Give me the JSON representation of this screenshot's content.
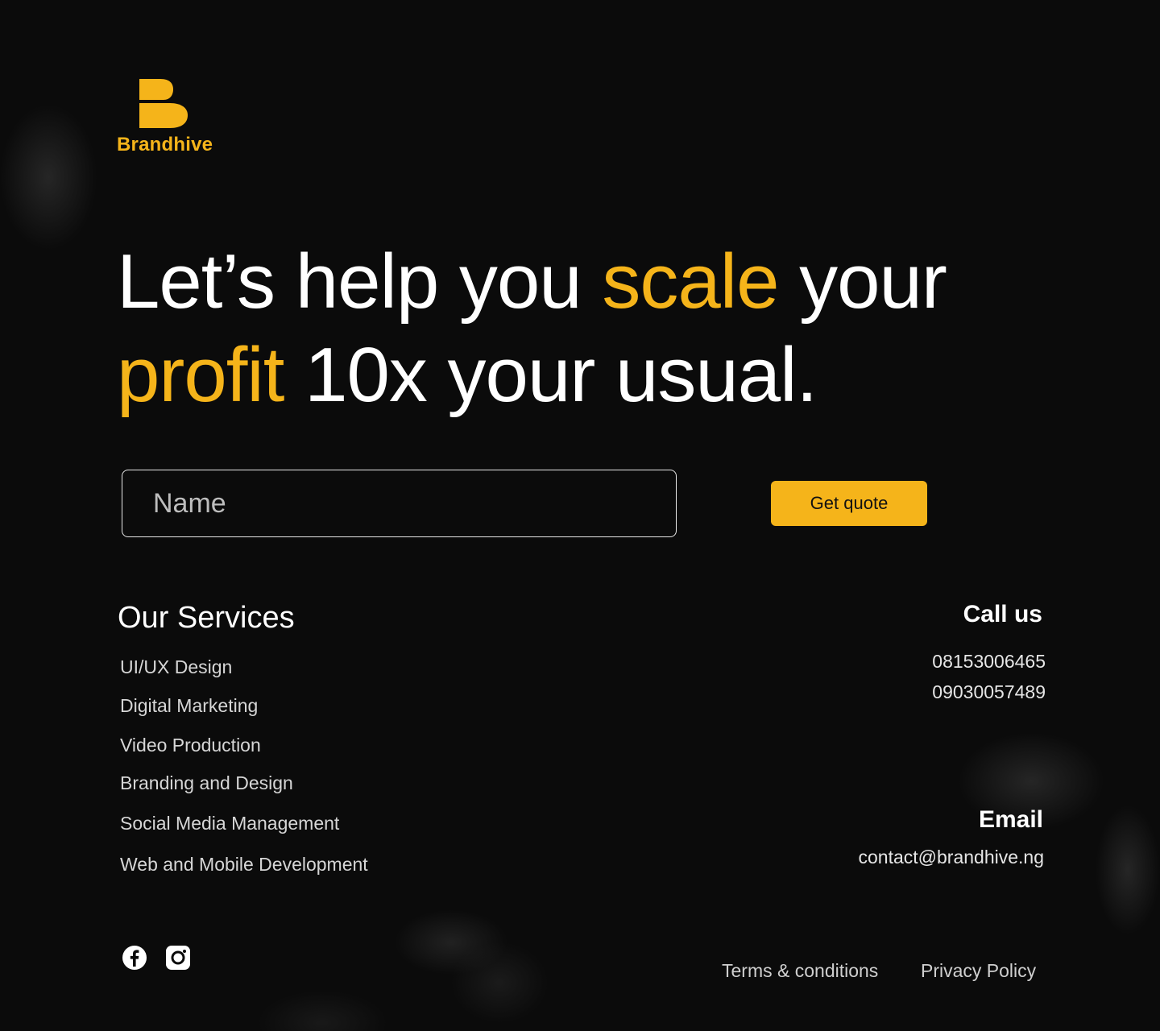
{
  "brand": {
    "name": "Brandhive",
    "logo_icon": "brandhive-b-logo-icon",
    "accent_color": "#F5B41A"
  },
  "hero": {
    "line1_part1": "Let’s help you ",
    "line1_accent": "scale",
    "line1_part2": " your",
    "line2_accent": "profit",
    "line2_part2": " 10x your usual."
  },
  "quote_form": {
    "name_placeholder": "Name",
    "name_value": "",
    "submit_label": "Get quote"
  },
  "services": {
    "title": "Our Services",
    "items": [
      "UI/UX Design",
      "Digital Marketing",
      "Video Production",
      "Branding and Design",
      "Social Media Management",
      "Web and Mobile Development"
    ]
  },
  "contact": {
    "call_title": "Call us",
    "phones": [
      "08153006465",
      "09030057489"
    ],
    "email_title": "Email",
    "email": "contact@brandhive.ng"
  },
  "social": [
    {
      "icon": "facebook-icon"
    },
    {
      "icon": "instagram-icon"
    }
  ],
  "footer": {
    "terms_label": "Terms & conditions",
    "privacy_label": "Privacy Policy"
  }
}
